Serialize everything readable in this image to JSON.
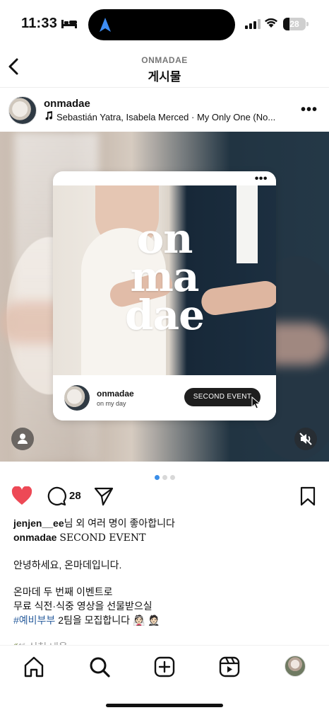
{
  "status": {
    "time": "11:33",
    "battery": "28",
    "battery_level": 0.28
  },
  "header": {
    "kicker": "ONMADAE",
    "title": "게시물"
  },
  "post": {
    "username": "onmadae",
    "music": "Sebastián Yatra, Isabela Merced · My Only One (No...",
    "card": {
      "wordmark_lines": [
        "on",
        "ma",
        "dae"
      ],
      "account_name": "onmadae",
      "account_sub": "on my day",
      "event_button": "SECOND EVENT"
    },
    "carousel_active": 0,
    "carousel_total": 3
  },
  "actions": {
    "comment_count": "28"
  },
  "caption": {
    "liked_by_user": "jenjen__ee",
    "liked_by_rest": "님 외 여러 명이 좋아합니다",
    "author": "onmadae",
    "headline": "SECOND EVENT",
    "greeting": "안녕하세요, 온마데입니다.",
    "line1": "온마데 두 번째 이벤트로",
    "line2": "무료 식전·식중 영상을 선물받으실",
    "hashtag": "#예비부부",
    "line3_rest": " 2팀을 모집합니다",
    "emoji": "👰🏻 🤵🏻",
    "line4": "🕊️ 신청 내용"
  },
  "colors": {
    "like": "#ed4956",
    "link": "#2c5f9e",
    "dot_active": "#3b8ee8"
  },
  "icons": [
    "bed-icon",
    "navigation-arrow-icon",
    "signal-icon",
    "wifi-icon",
    "back-chevron-icon",
    "more-icon",
    "music-note-icon",
    "person-icon",
    "mute-icon",
    "heart-icon",
    "comment-icon",
    "share-icon",
    "bookmark-icon",
    "home-icon",
    "search-icon",
    "add-icon",
    "reels-icon"
  ]
}
